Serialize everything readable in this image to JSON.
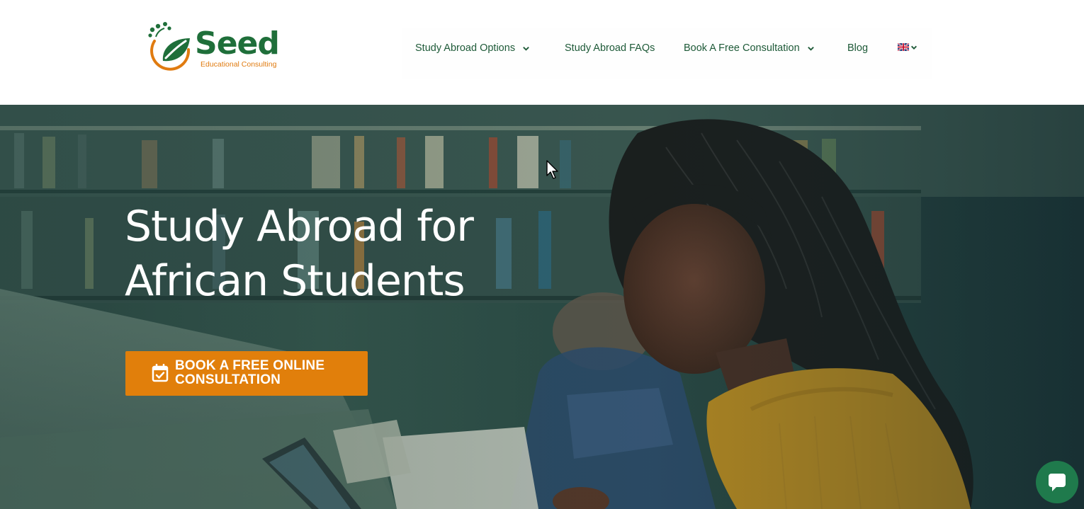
{
  "brand": {
    "name": "Seed",
    "tagline": "Educational Consulting",
    "primary_color": "#1f6f3a",
    "accent_color": "#e07b10"
  },
  "nav": {
    "items": [
      {
        "label": "Study Abroad Options",
        "has_dropdown": true
      },
      {
        "label": "Study Abroad FAQs",
        "has_dropdown": false
      },
      {
        "label": "Book A Free Consultation",
        "has_dropdown": true
      },
      {
        "label": "Blog",
        "has_dropdown": false
      }
    ],
    "language": {
      "icon": "uk-flag-icon",
      "has_dropdown": true
    }
  },
  "hero": {
    "title_line1": "Study Abroad for",
    "title_line2": "African Students",
    "cta": {
      "icon": "calendar-check-icon",
      "line1": "BOOK A FREE ONLINE",
      "line2": "CONSULTATION",
      "color": "#e17f0b"
    }
  },
  "chat_widget": {
    "icon": "chat-bubble-icon",
    "color": "#1f7a4c"
  }
}
